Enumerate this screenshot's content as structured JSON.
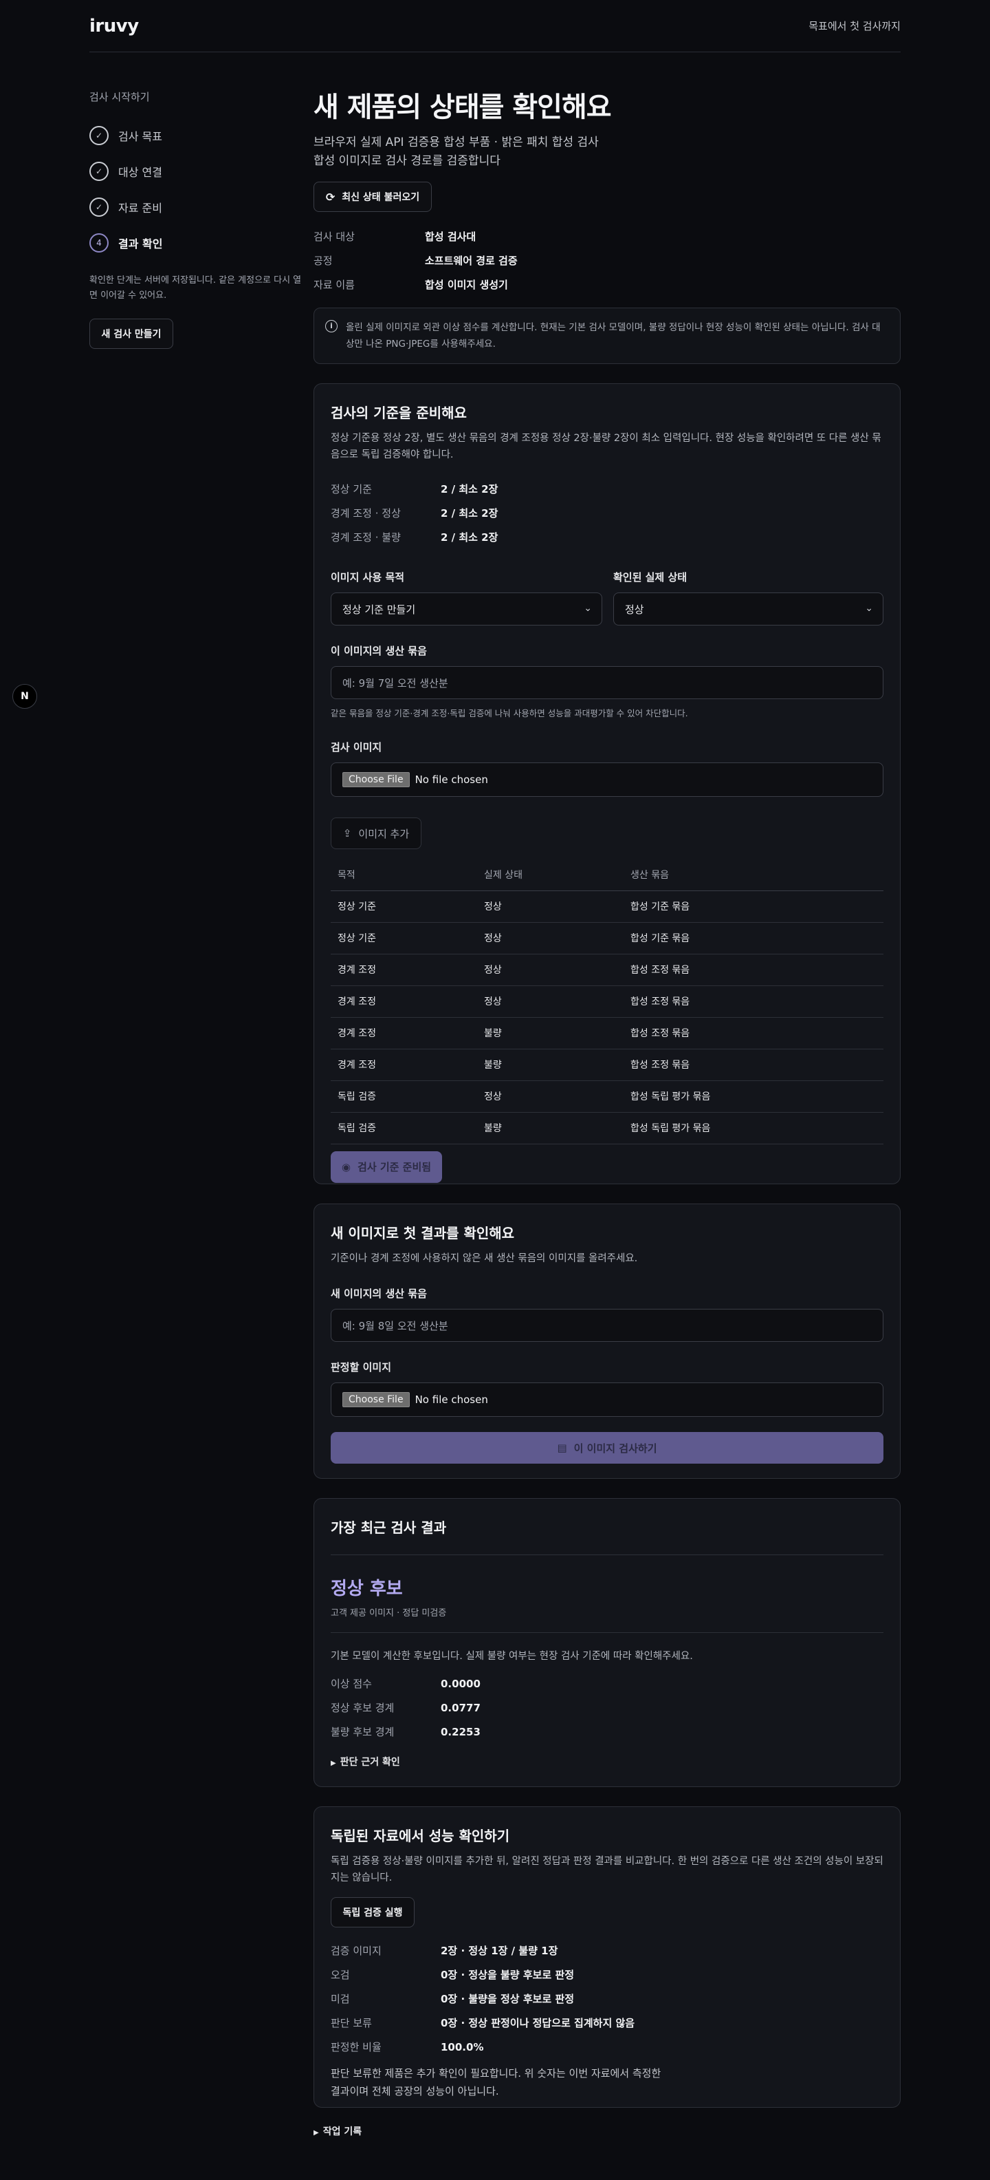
{
  "header": {
    "logo": "iruvy",
    "link": "목표에서 첫 검사까지"
  },
  "sidebar": {
    "title": "검사 시작하기",
    "steps": [
      {
        "label": "검사 목표",
        "state": "done"
      },
      {
        "label": "대상 연결",
        "state": "done"
      },
      {
        "label": "자료 준비",
        "state": "done"
      },
      {
        "label": "결과 확인",
        "state": "active",
        "number": "4"
      }
    ],
    "note": "확인한 단계는 서버에 저장됩니다. 같은 계정으로 다시 열면 이어갈 수 있어요.",
    "new_button": "새 검사 만들기"
  },
  "main": {
    "title": "새 제품의 상태를 확인해요",
    "subtitle_line1": "브라우저 실제 API 검증용 합성 부품 · 밝은 패치 합성 검사",
    "subtitle_line2": "합성 이미지로 검사 경로를 검증합니다",
    "refresh_button": "최신 상태 불러오기",
    "info": [
      {
        "k": "검사 대상",
        "v": "합성 검사대"
      },
      {
        "k": "공정",
        "v": "소프트웨어 경로 검증"
      },
      {
        "k": "자료 이름",
        "v": "합성 이미지 생성기"
      }
    ],
    "notice": "올린 실제 이미지로 외관 이상 점수를 계산합니다. 현재는 기본 검사 모델이며, 불량 정답이나 현장 성능이 확인된 상태는 아닙니다. 검사 대상만 나온 PNG·JPEG를 사용해주세요."
  },
  "prep": {
    "title": "검사의 기준을 준비해요",
    "desc": "정상 기준용 정상 2장, 별도 생산 묶음의 경계 조정용 정상 2장·불량 2장이 최소 입력입니다. 현장 성능을 확인하려면 또 다른 생산 묶음으로 독립 검증해야 합니다.",
    "counts": [
      {
        "k": "정상 기준",
        "v": "2 / 최소 2장"
      },
      {
        "k": "경계 조정 · 정상",
        "v": "2 / 최소 2장"
      },
      {
        "k": "경계 조정 · 불량",
        "v": "2 / 최소 2장"
      }
    ],
    "purpose_label": "이미지 사용 목적",
    "purpose_value": "정상 기준 만들기",
    "state_label": "확인된 실제 상태",
    "state_value": "정상",
    "batch_label": "이 이미지의 생산 묶음",
    "batch_placeholder": "예: 9월 7일 오전 생산분",
    "batch_hint": "같은 묶음을 정상 기준·경계 조정·독립 검증에 나눠 사용하면 성능을 과대평가할 수 있어 차단합니다.",
    "image_label": "검사 이미지",
    "file_button": "Choose File",
    "file_text": "No file chosen",
    "add_button": "이미지 추가",
    "table_headers": [
      "목적",
      "실제 상태",
      "생산 묶음"
    ],
    "rows": [
      [
        "정상 기준",
        "정상",
        "합성 기준 묶음"
      ],
      [
        "정상 기준",
        "정상",
        "합성 기준 묶음"
      ],
      [
        "경계 조정",
        "정상",
        "합성 조정 묶음"
      ],
      [
        "경계 조정",
        "정상",
        "합성 조정 묶음"
      ],
      [
        "경계 조정",
        "불량",
        "합성 조정 묶음"
      ],
      [
        "경계 조정",
        "불량",
        "합성 조정 묶음"
      ],
      [
        "독립 검증",
        "정상",
        "합성 독립 평가 묶음"
      ],
      [
        "독립 검증",
        "불량",
        "합성 독립 평가 묶음"
      ]
    ],
    "ready_button": "검사 기준 준비됨"
  },
  "first": {
    "title": "새 이미지로 첫 결과를 확인해요",
    "desc": "기준이나 경계 조정에 사용하지 않은 새 생산 묶음의 이미지를 올려주세요.",
    "batch_label": "새 이미지의 생산 묶음",
    "batch_placeholder": "예: 9월 8일 오전 생산분",
    "image_label": "판정할 이미지",
    "file_button": "Choose File",
    "file_text": "No file chosen",
    "inspect_button": "이 이미지 검사하기"
  },
  "latest": {
    "title": "가장 최근 검사 결과",
    "result": "정상 후보",
    "result_sub": "고객 제공 이미지 · 정답 미검증",
    "desc": "기본 모델이 계산한 후보입니다. 실제 불량 여부는 현장 검사 기준에 따라 확인해주세요.",
    "metrics": [
      {
        "k": "이상 점수",
        "v": "0.0000"
      },
      {
        "k": "정상 후보 경계",
        "v": "0.0777"
      },
      {
        "k": "불량 후보 경계",
        "v": "0.2253"
      }
    ],
    "details": "판단 근거 확인"
  },
  "perf": {
    "title": "독립된 자료에서 성능 확인하기",
    "desc": "독립 검증용 정상·불량 이미지를 추가한 뒤, 알려진 정답과 판정 결과를 비교합니다. 한 번의 검증으로 다른 생산 조건의 성능이 보장되지는 않습니다.",
    "run_button": "독립 검증 실행",
    "metrics": [
      {
        "k": "검증 이미지",
        "v": "2장 · 정상 1장 / 불량 1장"
      },
      {
        "k": "오검",
        "v": "0장 · 정상을 불량 후보로 판정"
      },
      {
        "k": "미검",
        "v": "0장 · 불량을 정상 후보로 판정"
      },
      {
        "k": "판단 보류",
        "v": "0장 · 정상 판정이나 정답으로 집계하지 않음"
      },
      {
        "k": "판정한 비율",
        "v": "100.0%"
      }
    ],
    "foot_line1": "판단 보류한 제품은 추가 확인이 필요합니다. 위 숫자는 이번 자료에서 측정한",
    "foot_line2": "결과이며 전체 공장의 성능이 아닙니다."
  },
  "log": {
    "label": "작업 기록"
  },
  "floating": {
    "label": "N"
  }
}
